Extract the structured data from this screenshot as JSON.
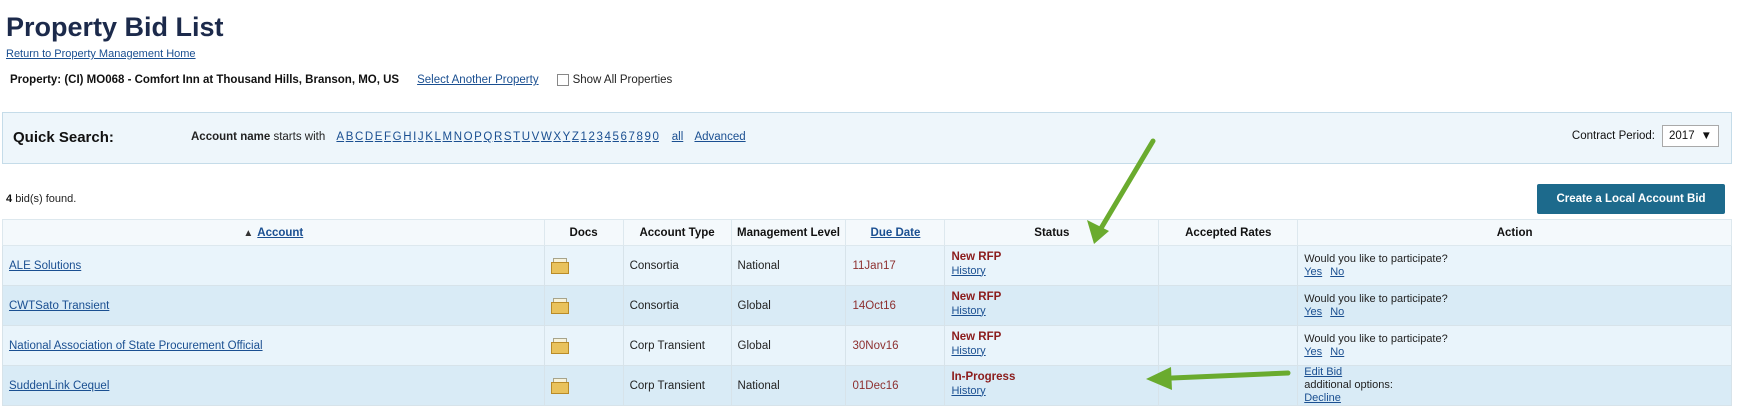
{
  "header": {
    "title": "Property Bid List",
    "return_link": "Return to Property Management Home",
    "property_label": "Property: (CI) MO068 - Comfort Inn at Thousand Hills, Branson, MO, US",
    "select_another": "Select Another Property",
    "show_all": "Show All Properties"
  },
  "quick_search": {
    "title": "Quick Search:",
    "account_name_label": "Account name",
    "starts_with": "starts with",
    "letters": [
      "A",
      "B",
      "C",
      "D",
      "E",
      "F",
      "G",
      "H",
      "I",
      "J",
      "K",
      "L",
      "M",
      "N",
      "O",
      "P",
      "Q",
      "R",
      "S",
      "T",
      "U",
      "V",
      "W",
      "X",
      "Y",
      "Z",
      "1",
      "2",
      "3",
      "4",
      "5",
      "6",
      "7",
      "8",
      "9",
      "0"
    ],
    "all": "all",
    "advanced": "Advanced",
    "contract_period_label": "Contract Period:",
    "contract_period_value": "2017"
  },
  "results": {
    "count_text": "4",
    "found_suffix": "bid(s) found.",
    "create_button": "Create a Local Account Bid"
  },
  "table": {
    "headers": {
      "account": "Account",
      "docs": "Docs",
      "account_type": "Account Type",
      "management_level": "Management Level",
      "due_date": "Due Date",
      "status": "Status",
      "accepted_rates": "Accepted Rates",
      "action": "Action"
    },
    "rows": [
      {
        "account": "ALE Solutions",
        "account_type": "Consortia",
        "management_level": "National",
        "due_date": "11Jan17",
        "status": "New RFP",
        "history": "History",
        "accepted_rates": "",
        "action_text": "Would you like to participate?",
        "action_link1": "Yes",
        "action_link2": "No"
      },
      {
        "account": "CWTSato Transient",
        "account_type": "Consortia",
        "management_level": "Global",
        "due_date": "14Oct16",
        "status": "New RFP",
        "history": "History",
        "accepted_rates": "",
        "action_text": "Would you like to participate?",
        "action_link1": "Yes",
        "action_link2": "No"
      },
      {
        "account": "National Association of State Procurement Official",
        "account_type": "Corp Transient",
        "management_level": "Global",
        "due_date": "30Nov16",
        "status": "New RFP",
        "history": "History",
        "accepted_rates": "",
        "action_text": "Would you like to participate?",
        "action_link1": "Yes",
        "action_link2": "No"
      },
      {
        "account": "SuddenLink Cequel",
        "account_type": "Corp Transient",
        "management_level": "National",
        "due_date": "01Dec16",
        "status": "In-Progress",
        "history": "History",
        "accepted_rates": "",
        "action_edit": "Edit Bid",
        "action_additional": "additional options:",
        "action_decline": "Decline"
      }
    ]
  },
  "colors": {
    "title": "#1c2a4b",
    "link": "#1a4f91",
    "status": "#8b1b1b",
    "button": "#1d6a8c",
    "annotation_arrow": "#6aab2e"
  }
}
